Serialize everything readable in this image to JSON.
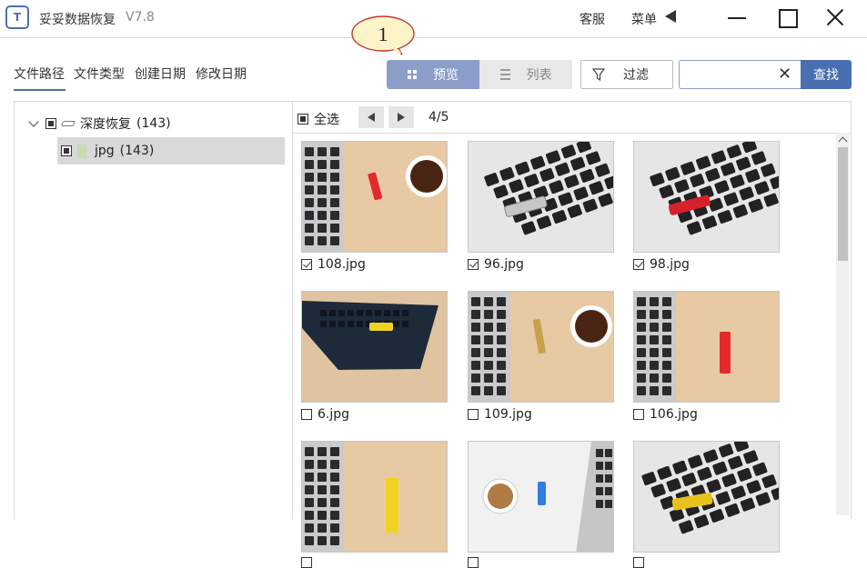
{
  "app": {
    "title": "妥妥数据恢复",
    "version": "V7.8",
    "logo_text": "T",
    "support_label": "客服",
    "menu_label": "菜单"
  },
  "sort_tabs": [
    "文件路径",
    "文件类型",
    "创建日期",
    "修改日期"
  ],
  "toolbar": {
    "preview_label": "预览",
    "list_label": "列表",
    "filter_label": "过滤",
    "search_placeholder": "",
    "search_value": "",
    "search_button": "查找",
    "callout_number": "1"
  },
  "tree": {
    "root": {
      "label": "深度恢复",
      "count": "(143)"
    },
    "child": {
      "label": "jpg",
      "count": "(143)"
    }
  },
  "gallery": {
    "select_all_label": "全选",
    "page_indicator": "4/5",
    "items": [
      {
        "name": "108.jpg",
        "checked": true
      },
      {
        "name": "96.jpg",
        "checked": true
      },
      {
        "name": "98.jpg",
        "checked": true
      },
      {
        "name": "6.jpg",
        "checked": false
      },
      {
        "name": "109.jpg",
        "checked": false
      },
      {
        "name": "106.jpg",
        "checked": false
      },
      {
        "name": "",
        "checked": false
      },
      {
        "name": "",
        "checked": false
      },
      {
        "name": "",
        "checked": false
      }
    ]
  },
  "colors": {
    "accent": "#4a6fb0",
    "preview_active": "#8a9ec9",
    "selected_row": "#d9d9d9",
    "callout_fill": "#fdf5c9",
    "callout_border": "#c0392b"
  }
}
